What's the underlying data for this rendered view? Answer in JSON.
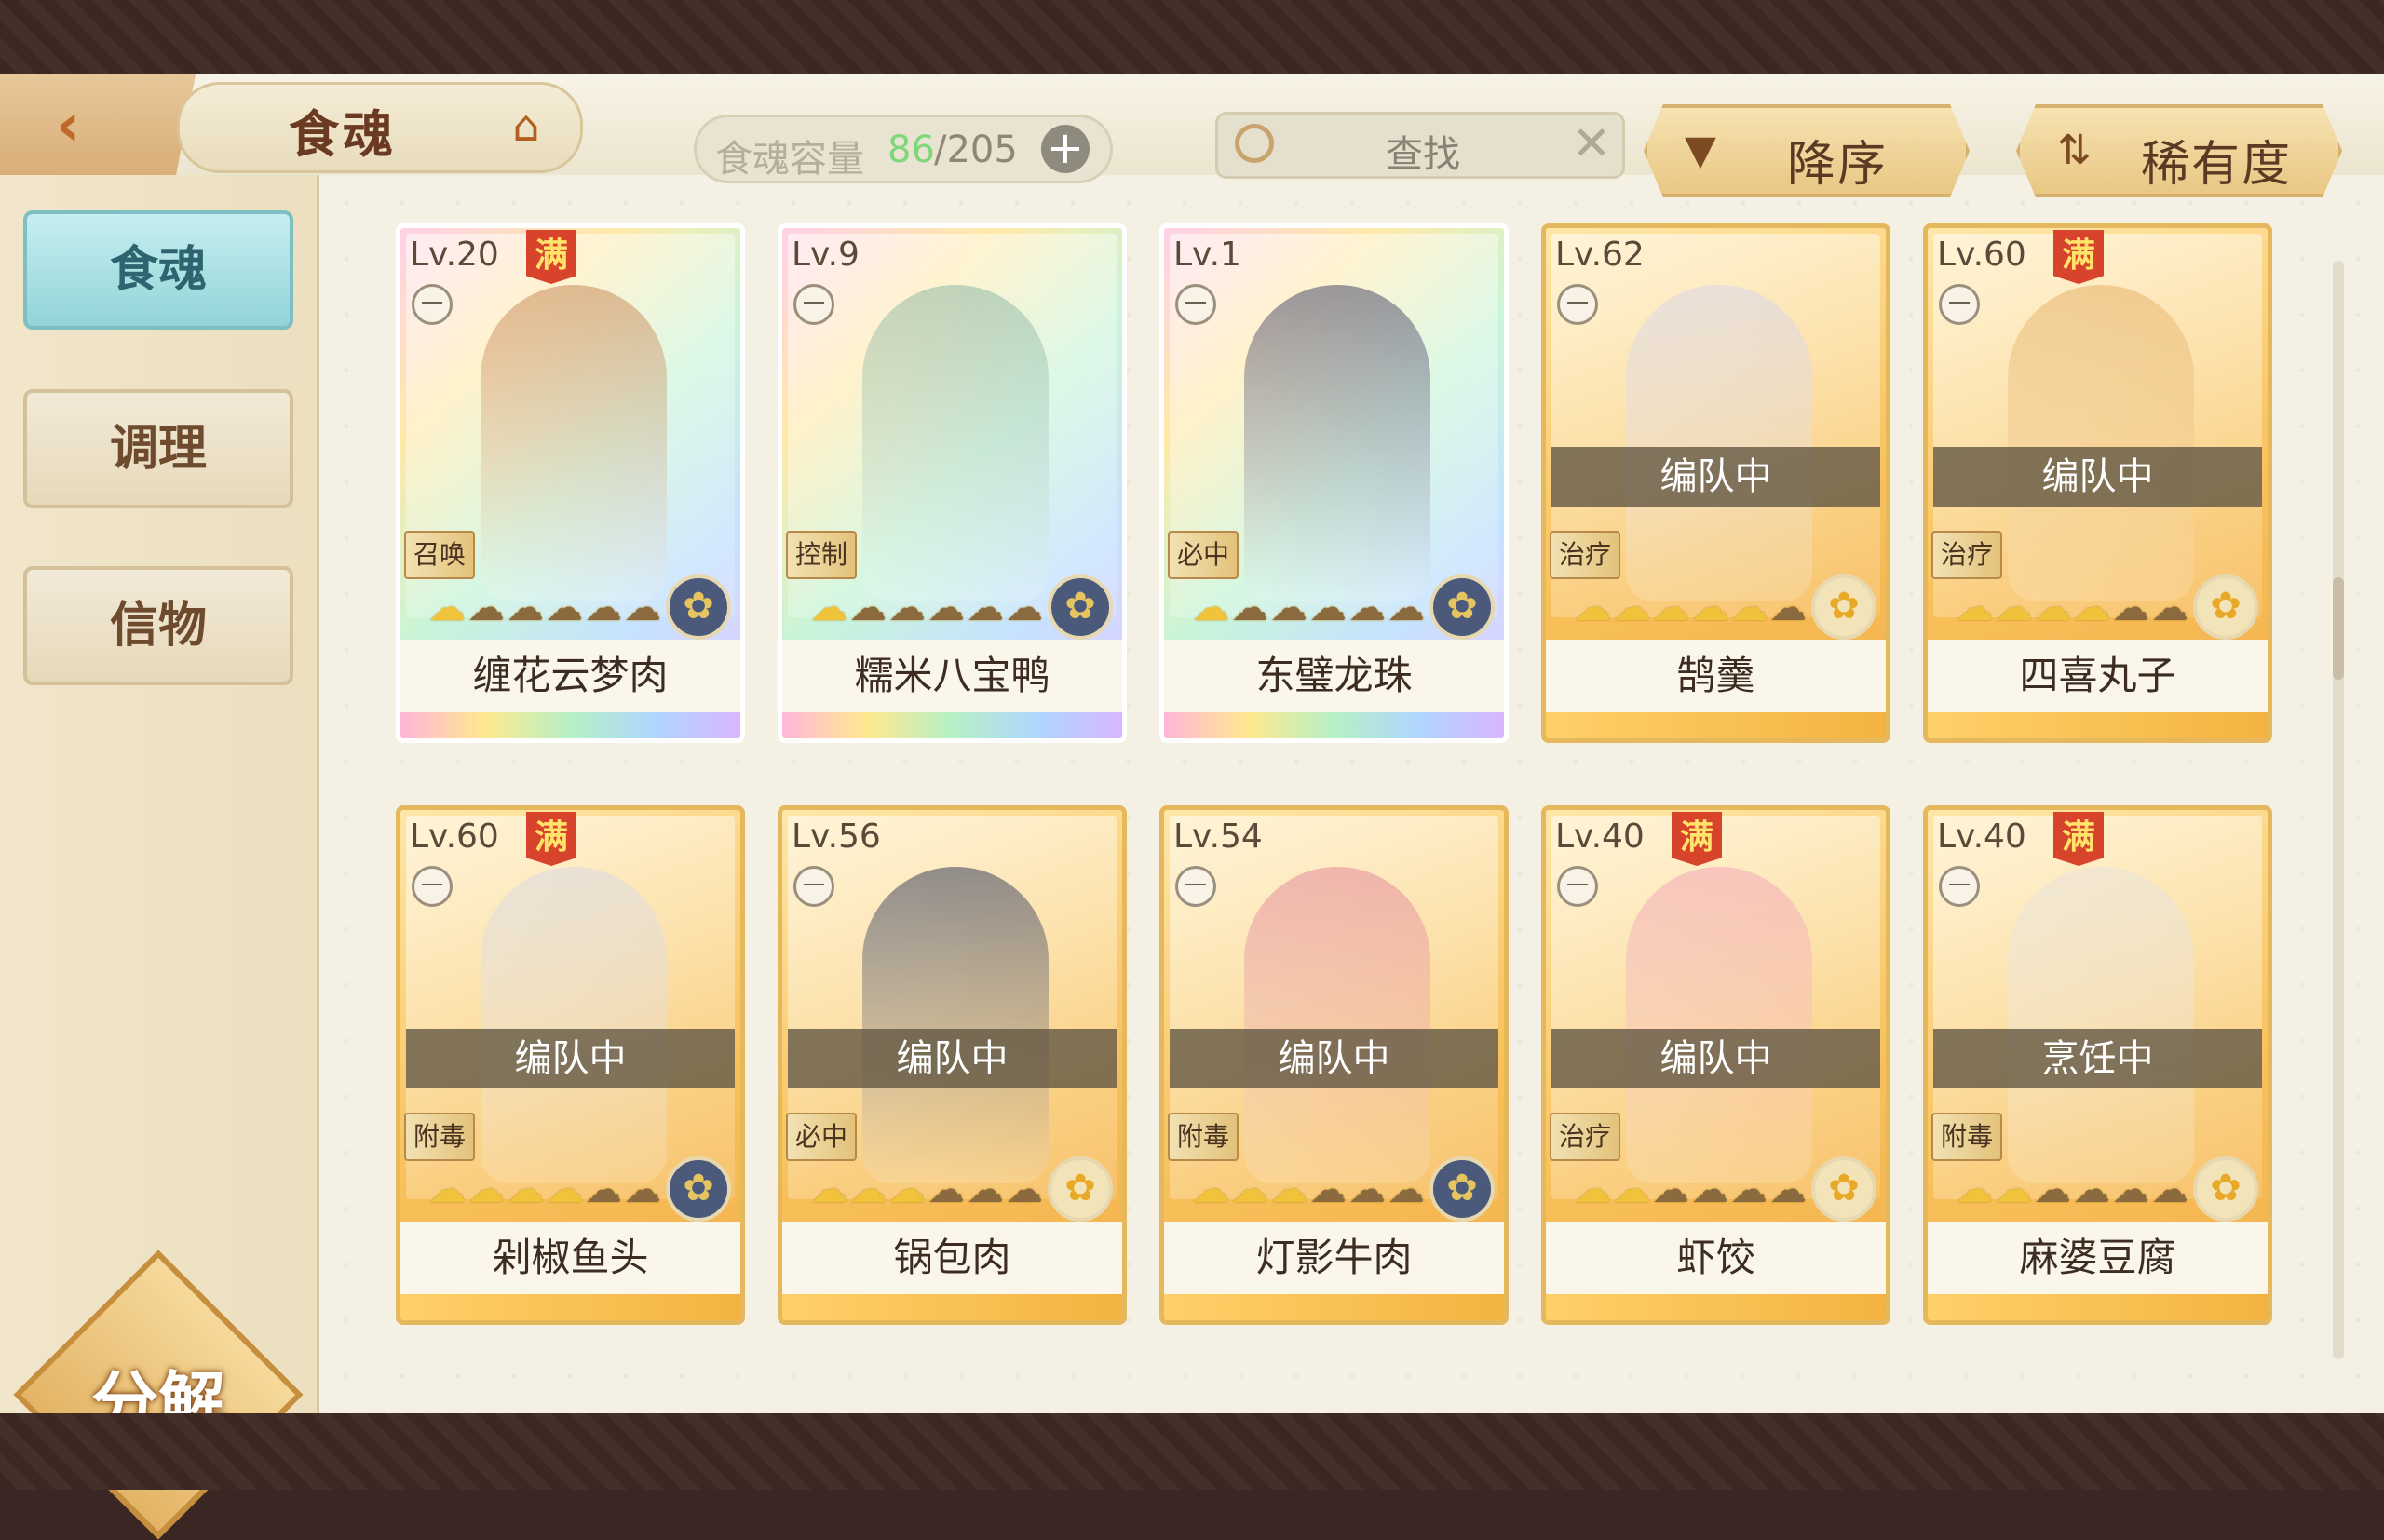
{
  "header": {
    "title": "食魂",
    "capacity_label": "食魂容量",
    "capacity_current": "86",
    "capacity_max": "/205",
    "capacity_plus": "+",
    "search_placeholder": "查找",
    "search_clear": "✕",
    "sort_order_label": "降序",
    "sort_order_icon": "▼",
    "sort_field_label": "稀有度",
    "sort_field_icon": "⇅",
    "back_icon": "‹",
    "home_icon": "⌂"
  },
  "sidebar": {
    "items": [
      {
        "label": "食魂",
        "active": true
      },
      {
        "label": "调理",
        "active": false
      },
      {
        "label": "信物",
        "active": false
      }
    ],
    "decompose_label": "分解"
  },
  "full_badge": "满",
  "bowl_icon": "一",
  "cards": [
    {
      "level": "Lv.20",
      "full": true,
      "status": "",
      "role": "召唤",
      "stars_on": 1,
      "stars_total": 6,
      "name": "缠花云梦肉",
      "rainbow": true,
      "type": "blue"
    },
    {
      "level": "Lv.9",
      "full": false,
      "status": "",
      "role": "控制",
      "stars_on": 1,
      "stars_total": 6,
      "name": "糯米八宝鸭",
      "rainbow": true,
      "type": "blue"
    },
    {
      "level": "Lv.1",
      "full": false,
      "status": "",
      "role": "必中",
      "stars_on": 1,
      "stars_total": 6,
      "name": "东璧龙珠",
      "rainbow": true,
      "type": "blue"
    },
    {
      "level": "Lv.62",
      "full": false,
      "status": "编队中",
      "role": "治疗",
      "stars_on": 5,
      "stars_total": 6,
      "name": "鹄羹",
      "rainbow": false,
      "type": "gold"
    },
    {
      "level": "Lv.60",
      "full": true,
      "status": "编队中",
      "role": "治疗",
      "stars_on": 4,
      "stars_total": 6,
      "name": "四喜丸子",
      "rainbow": false,
      "type": "gold"
    },
    {
      "level": "Lv.60",
      "full": true,
      "status": "编队中",
      "role": "附毒",
      "stars_on": 4,
      "stars_total": 6,
      "name": "剁椒鱼头",
      "rainbow": false,
      "type": "blue"
    },
    {
      "level": "Lv.56",
      "full": false,
      "status": "编队中",
      "role": "必中",
      "stars_on": 3,
      "stars_total": 6,
      "name": "锅包肉",
      "rainbow": false,
      "type": "gold"
    },
    {
      "level": "Lv.54",
      "full": false,
      "status": "编队中",
      "role": "附毒",
      "stars_on": 3,
      "stars_total": 6,
      "name": "灯影牛肉",
      "rainbow": false,
      "type": "blue"
    },
    {
      "level": "Lv.40",
      "full": true,
      "status": "编队中",
      "role": "治疗",
      "stars_on": 2,
      "stars_total": 6,
      "name": "虾饺",
      "rainbow": false,
      "type": "gold"
    },
    {
      "level": "Lv.40",
      "full": true,
      "status": "烹饪中",
      "role": "附毒",
      "stars_on": 2,
      "stars_total": 6,
      "name": "麻婆豆腐",
      "rainbow": false,
      "type": "gold"
    }
  ],
  "colors": {
    "frame": "#3c2723",
    "background": "#f4f1e4",
    "active_tab": "#93d4d8",
    "gold_card": "#f8c05a",
    "capacity_current": "#7ed87a",
    "full_badge": "#d8432c"
  }
}
